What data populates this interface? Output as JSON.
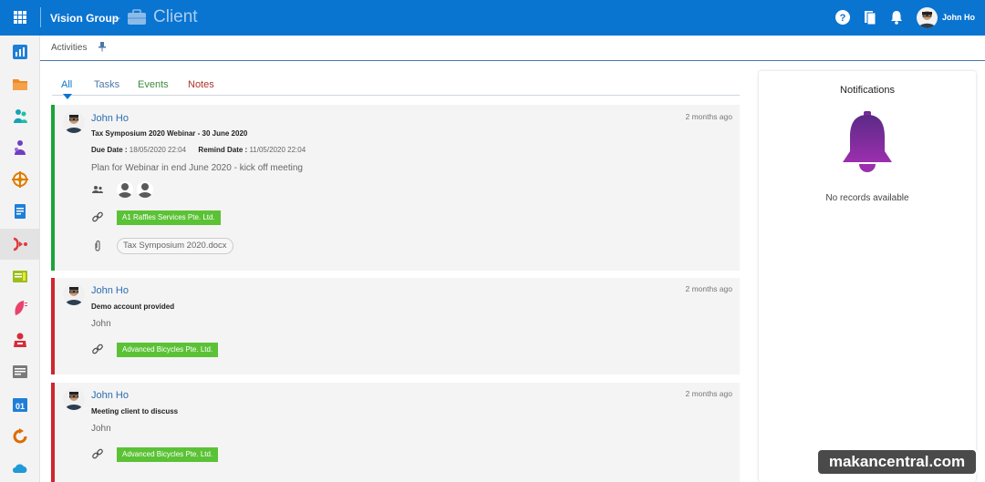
{
  "header": {
    "org_name": "Vision Group",
    "separator": "–",
    "app_title": "Client",
    "user_name": "John Ho",
    "icons": [
      "app-launcher-icon",
      "help-icon",
      "bookmarks-icon",
      "bell-icon"
    ]
  },
  "sidebar": {
    "items": [
      {
        "icon": "dashboard-icon",
        "color": "#1f7fd8"
      },
      {
        "icon": "folder-icon",
        "color": "#f08a24"
      },
      {
        "icon": "contacts-icon",
        "color": "#17a2b8"
      },
      {
        "icon": "teams-icon",
        "color": "#6f3fc2"
      },
      {
        "icon": "target-icon",
        "color": "#e07b00"
      },
      {
        "icon": "document-icon",
        "color": "#1f7fd8"
      },
      {
        "icon": "activity-icon",
        "color": "#e03a3a",
        "active": true
      },
      {
        "icon": "ledger-icon",
        "color": "#9bbf1a"
      },
      {
        "icon": "leaf-icon",
        "color": "#e8436b"
      },
      {
        "icon": "bag-icon",
        "color": "#d82b3a"
      },
      {
        "icon": "report-icon",
        "color": "#7a7a7a"
      },
      {
        "icon": "calendar-icon",
        "color": "#1f7fd8"
      },
      {
        "icon": "refresh-icon",
        "color": "#e06b00"
      },
      {
        "icon": "cloud-icon",
        "color": "#1f9ad8"
      }
    ]
  },
  "breadcrumb": {
    "label": "Activities"
  },
  "tabs": [
    {
      "label": "All",
      "active": true
    },
    {
      "label": "Tasks"
    },
    {
      "label": "Events"
    },
    {
      "label": "Notes"
    }
  ],
  "activities": [
    {
      "author": "John Ho",
      "time": "2 months ago",
      "subject": "Tax Symposium 2020 Webinar - 30 June 2020",
      "due_label": "Due Date :",
      "due_value": "18/05/2020 22:04",
      "remind_label": "Remind Date :",
      "remind_value": "11/05/2020 22:04",
      "description": "Plan for Webinar in end June 2020 - kick off meeting",
      "link": "A1 Raffles Services Pte. Ltd.",
      "attachment": "Tax Symposium 2020.docx",
      "status_color": "#1aa53a"
    },
    {
      "author": "John Ho",
      "time": "2 months ago",
      "subject": "Demo account provided",
      "description": "John",
      "link": "Advanced Bicycles Pte. Ltd.",
      "status_color": "#d0262f"
    },
    {
      "author": "John Ho",
      "time": "2 months ago",
      "subject": "Meeting client to discuss",
      "description": "John",
      "link": "Advanced Bicycles Pte. Ltd.",
      "status_color": "#d0262f"
    }
  ],
  "notifications": {
    "title": "Notifications",
    "empty_text": "No records available"
  },
  "watermark": "makancentral.com",
  "colors": {
    "header_bg": "#0a74d1",
    "tag_green": "#5bc236",
    "link_blue": "#2a6db2"
  }
}
